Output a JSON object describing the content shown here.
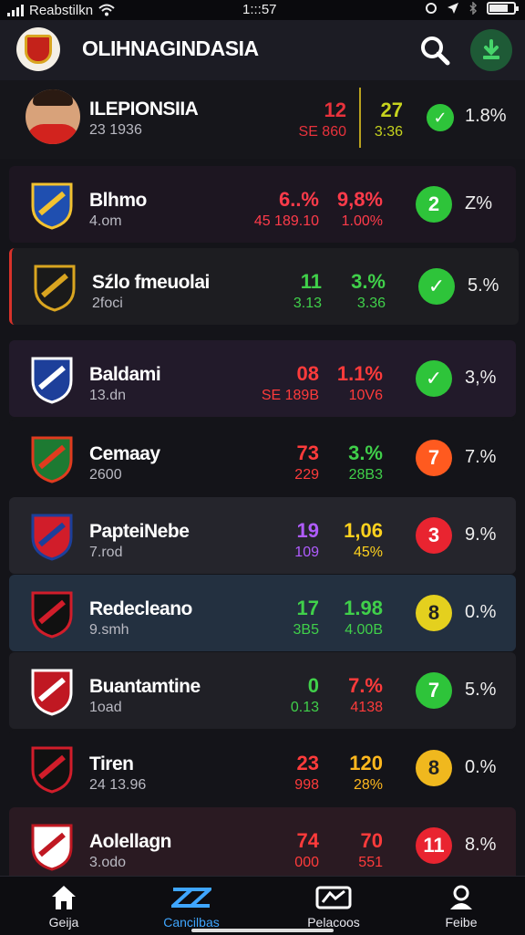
{
  "status": {
    "carrier": "Reabstilkn",
    "time": "1:::57"
  },
  "app": {
    "title": "OLIHNAGINDASIA",
    "colors": {
      "background": "#141419",
      "header": "#1c1c24",
      "accent": "#3fa6ff"
    }
  },
  "featured": {
    "name": "ILEPIONSIIA",
    "sub": "23 1936",
    "v1": "12",
    "v1_sub": "SE 860",
    "v2": "27",
    "v2_sub": "3:36",
    "status_icon": "check-icon",
    "pct": "1.8%",
    "colors": {
      "v1": "#e8323c",
      "v2": "#c6d31e",
      "check": "#2ec43a"
    }
  },
  "rows": [
    {
      "name": "Blhmo",
      "sub": "4.om",
      "v1": "6..%",
      "v1_sub": "45 189.10",
      "v2": "9,8%",
      "v2_sub": "1.00%",
      "indicator": "2",
      "indicator_color": "#2ec43a",
      "pct": "Z%",
      "bg": "#1d1621",
      "v1_color": "#ff3b4a",
      "v2_color": "#ff3b4a"
    },
    {
      "name": "Sźlo fmeuolai",
      "sub": "2foci",
      "v1": "11",
      "v1_sub": "3.13",
      "v2": "3.%",
      "v2_sub": "3.36",
      "indicator": "✓",
      "indicator_color": "#2ec43a",
      "pct": "5.%",
      "bg": "#1d1d21",
      "v1_color": "#40d04a",
      "v2_color": "#40d04a"
    },
    {
      "name": "Baldami",
      "sub": "13.dn",
      "v1": "08",
      "v1_sub": "SE 189B",
      "v2": "1.1%",
      "v2_sub": "10V6",
      "indicator": "✓",
      "indicator_color": "#2ec43a",
      "pct": "3,%",
      "bg": "#221a2a",
      "v1_color": "#ff3b3b",
      "v2_color": "#ff3b3b"
    },
    {
      "name": "Cemaay",
      "sub": "2600",
      "v1": "73",
      "v1_sub": "229",
      "v2": "3.%",
      "v2_sub": "28B3",
      "indicator": "7",
      "indicator_color": "#ff5a1f",
      "pct": "7.%",
      "bg": "#141419",
      "v1_color": "#ff3b3b",
      "v2_color": "#40d04a"
    },
    {
      "name": "PapteiNebe",
      "sub": "7.rod",
      "v1": "19",
      "v1_sub": "109",
      "v2": "1,06",
      "v2_sub": "45%",
      "indicator": "3",
      "indicator_color": "#e92430",
      "pct": "9.%",
      "bg": "#25252c",
      "v1_color": "#b05cff",
      "v2_color": "#ffd21e"
    },
    {
      "name": "Redecleano",
      "sub": "9.smh",
      "v1": "17",
      "v1_sub": "3B5",
      "v2": "1.98",
      "v2_sub": "4.00B",
      "indicator": "8",
      "indicator_color": "#e4d01e",
      "pct": "0.%",
      "bg": "#233040",
      "v1_color": "#40d04a",
      "v2_color": "#40d04a"
    },
    {
      "name": "Buantamtine",
      "sub": "1oad",
      "v1": "0",
      "v1_sub": "0.13",
      "v2": "7.%",
      "v2_sub": "4138",
      "indicator": "7",
      "indicator_color": "#2ec43a",
      "pct": "5.%",
      "bg": "#202026",
      "v1_color": "#40d04a",
      "v2_color": "#ff3b3b"
    },
    {
      "name": "Tiren",
      "sub": "24 13.96",
      "v1": "23",
      "v1_sub": "998",
      "v2": "120",
      "v2_sub": "28%",
      "indicator": "8",
      "indicator_color": "#f0b81e",
      "pct": "0.%",
      "bg": "#141419",
      "v1_color": "#ff3b3b",
      "v2_color": "#ffb81e"
    },
    {
      "name": "Aolellagn",
      "sub": "3.odo",
      "v1": "74",
      "v1_sub": "000",
      "v2": "70",
      "v2_sub": "551",
      "indicator": "11",
      "indicator_color": "#e92430",
      "pct": "8.%",
      "bg": "#2a1a22",
      "v1_color": "#ff3b3b",
      "v2_color": "#ff3b3b"
    }
  ],
  "tabs": [
    {
      "label": "Geija",
      "icon": "home-icon"
    },
    {
      "label": "Cancilbas",
      "icon": "scores-icon",
      "active": true
    },
    {
      "label": "Pelacoos",
      "icon": "stats-icon"
    },
    {
      "label": "Feibe",
      "icon": "profile-icon"
    }
  ]
}
